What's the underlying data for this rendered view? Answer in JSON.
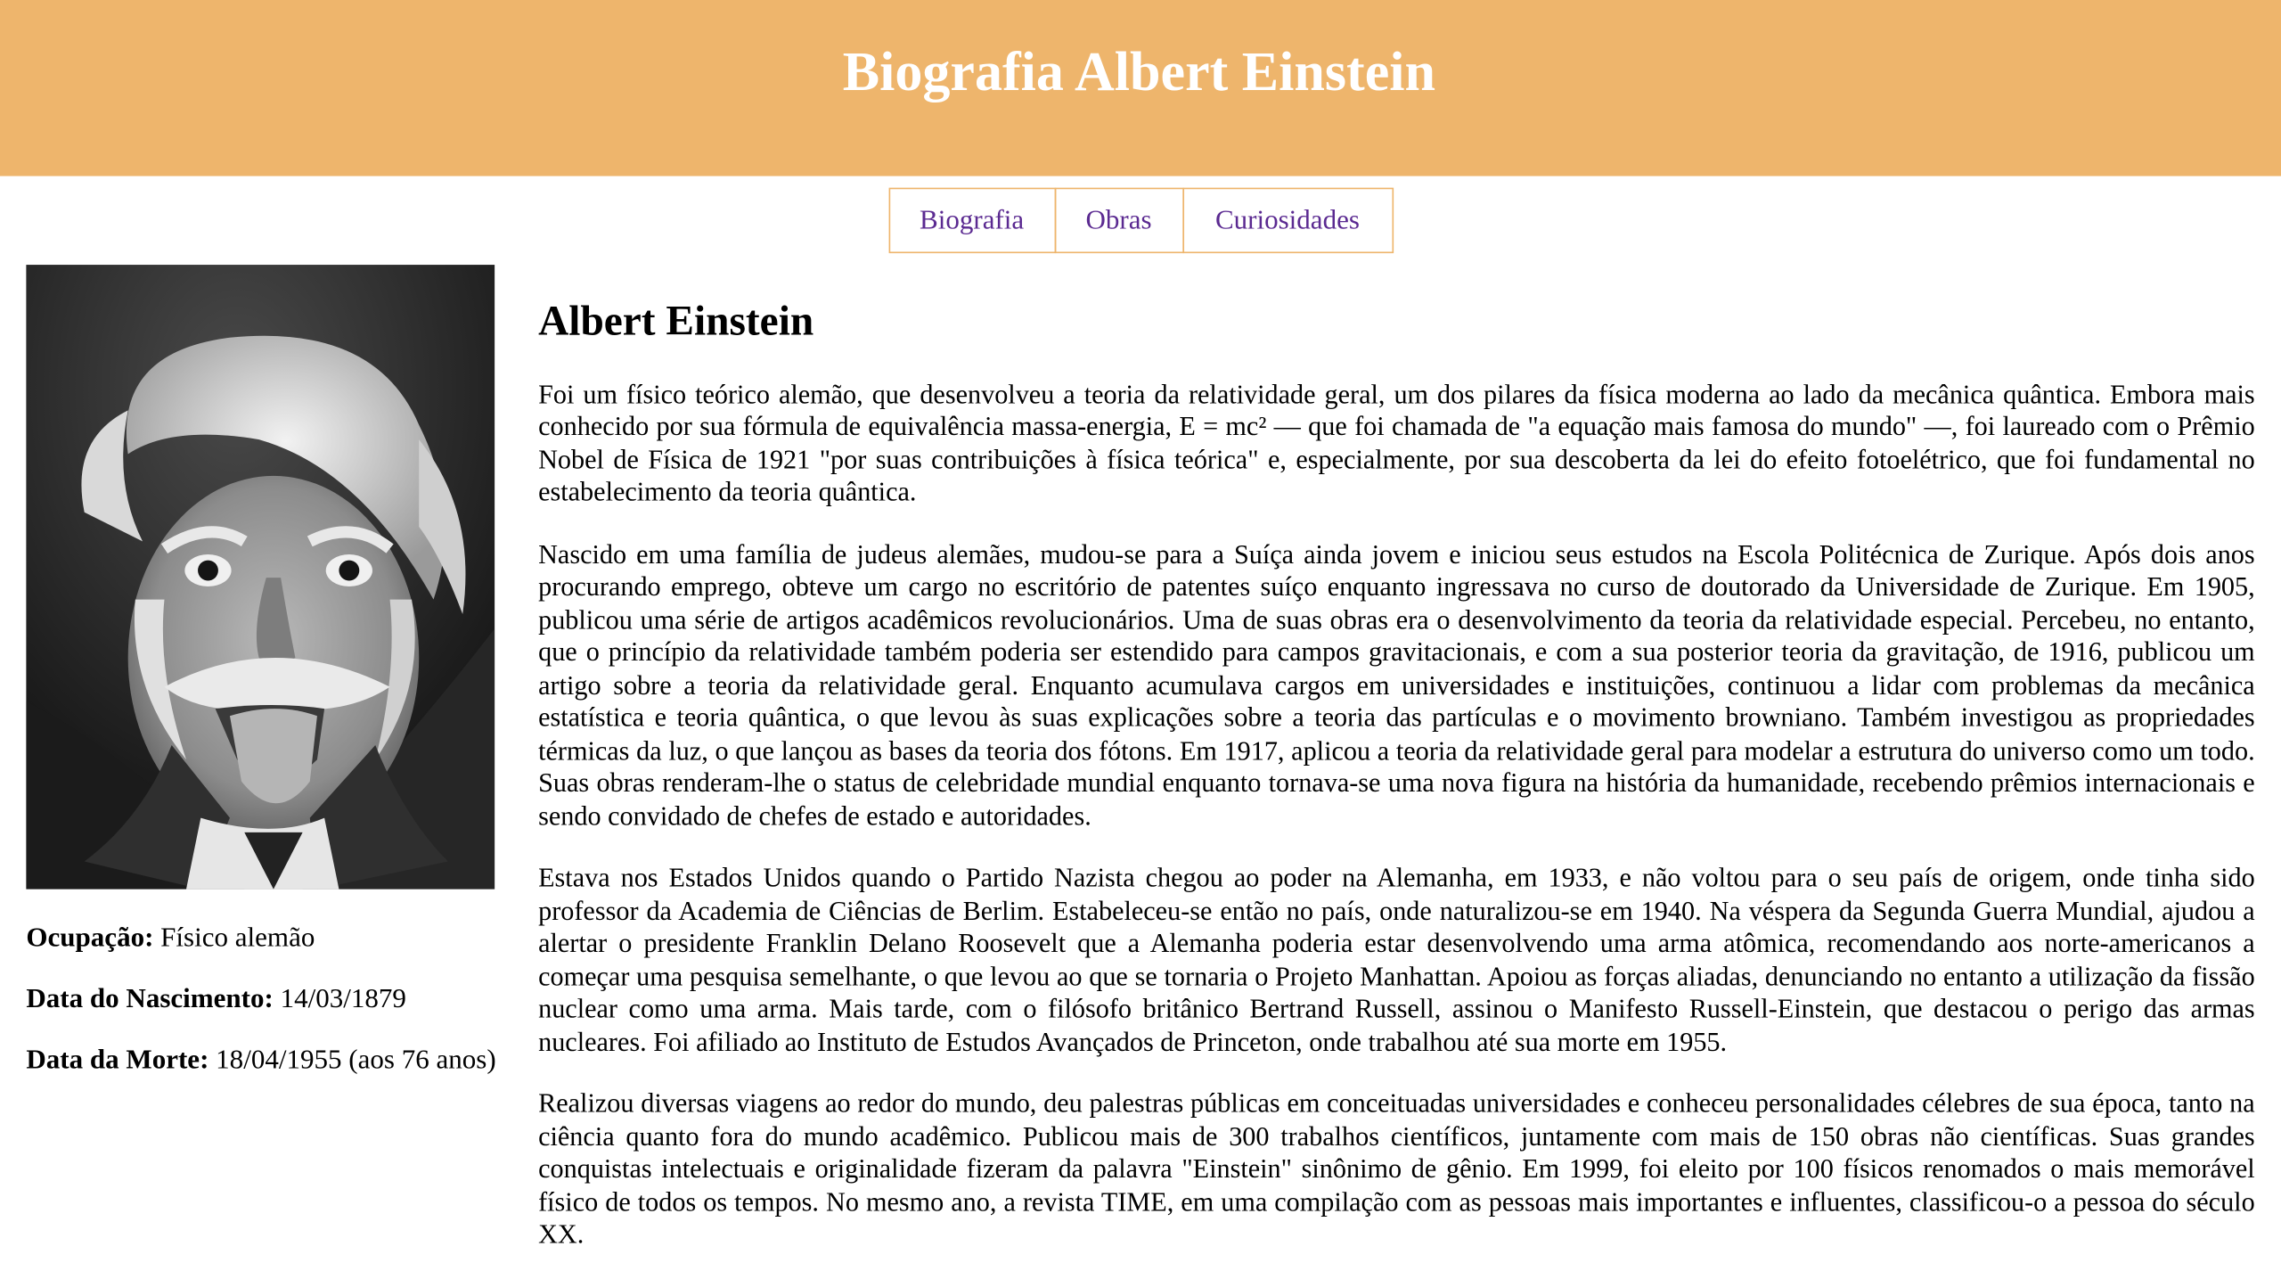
{
  "header": {
    "title": "Biografia Albert Einstein"
  },
  "nav": {
    "items": [
      "Biografia",
      "Obras",
      "Curiosidades"
    ]
  },
  "sidebar": {
    "image_alt": "Albert Einstein",
    "occupation_label": "Ocupação:",
    "occupation_value": " Físico alemão",
    "birth_label": "Data do Nascimento:",
    "birth_value": " 14/03/1879",
    "death_label": "Data da Morte:",
    "death_value": " 18/04/1955 (aos 76 anos)"
  },
  "main": {
    "title": "Albert Einstein",
    "paragraphs": [
      "Foi um físico teórico alemão, que desenvolveu a teoria da relatividade geral, um dos pilares da física moderna ao lado da mecânica quântica. Embora mais conhecido por sua fórmula de equivalência massa-energia, E = mc² — que foi chamada de \"a equação mais famosa do mundo\" —, foi laureado com o Prêmio Nobel de Física de 1921 \"por suas contribuições à física teórica\" e, especialmente, por sua descoberta da lei do efeito fotoelétrico, que foi fundamental no estabelecimento da teoria quântica.",
      "Nascido em uma família de judeus alemães, mudou-se para a Suíça ainda jovem e iniciou seus estudos na Escola Politécnica de Zurique. Após dois anos procurando emprego, obteve um cargo no escritório de patentes suíço enquanto ingressava no curso de doutorado da Universidade de Zurique. Em 1905, publicou uma série de artigos acadêmicos revolucionários. Uma de suas obras era o desenvolvimento da teoria da relatividade especial. Percebeu, no entanto, que o princípio da relatividade também poderia ser estendido para campos gravitacionais, e com a sua posterior teoria da gravitação, de 1916, publicou um artigo sobre a teoria da relatividade geral. Enquanto acumulava cargos em universidades e instituições, continuou a lidar com problemas da mecânica estatística e teoria quântica, o que levou às suas explicações sobre a teoria das partículas e o movimento browniano. Também investigou as propriedades térmicas da luz, o que lançou as bases da teoria dos fótons. Em 1917, aplicou a teoria da relatividade geral para modelar a estrutura do universo como um todo. Suas obras renderam-lhe o status de celebridade mundial enquanto tornava-se uma nova figura na história da humanidade, recebendo prêmios internacionais e sendo convidado de chefes de estado e autoridades.",
      "Estava nos Estados Unidos quando o Partido Nazista chegou ao poder na Alemanha, em 1933, e não voltou para o seu país de origem, onde tinha sido professor da Academia de Ciências de Berlim. Estabeleceu-se então no país, onde naturalizou-se em 1940. Na véspera da Segunda Guerra Mundial, ajudou a alertar o presidente Franklin Delano Roosevelt que a Alemanha poderia estar desenvolvendo uma arma atômica, recomendando aos norte-americanos a começar uma pesquisa semelhante, o que levou ao que se tornaria o Projeto Manhattan. Apoiou as forças aliadas, denunciando no entanto a utilização da fissão nuclear como uma arma. Mais tarde, com o filósofo britânico Bertrand Russell, assinou o Manifesto Russell-Einstein, que destacou o perigo das armas nucleares. Foi afiliado ao Instituto de Estudos Avançados de Princeton, onde trabalhou até sua morte em 1955.",
      "Realizou diversas viagens ao redor do mundo, deu palestras públicas em conceituadas universidades e conheceu personalidades célebres de sua época, tanto na ciência quanto fora do mundo acadêmico. Publicou mais de 300 trabalhos científicos, juntamente com mais de 150 obras não científicas. Suas grandes conquistas intelectuais e originalidade fizeram da palavra \"Einstein\" sinônimo de gênio. Em 1999, foi eleito por 100 físicos renomados o mais memorável físico de todos os tempos. No mesmo ano, a revista TIME, em uma compilação com as pessoas mais importantes e influentes, classificou-o a pessoa do século XX."
    ]
  },
  "colors": {
    "header_bg": "#EEB56C",
    "header_text": "#FFFFFF",
    "nav_border": "#EEB56C",
    "nav_link": "#5B2A91"
  }
}
